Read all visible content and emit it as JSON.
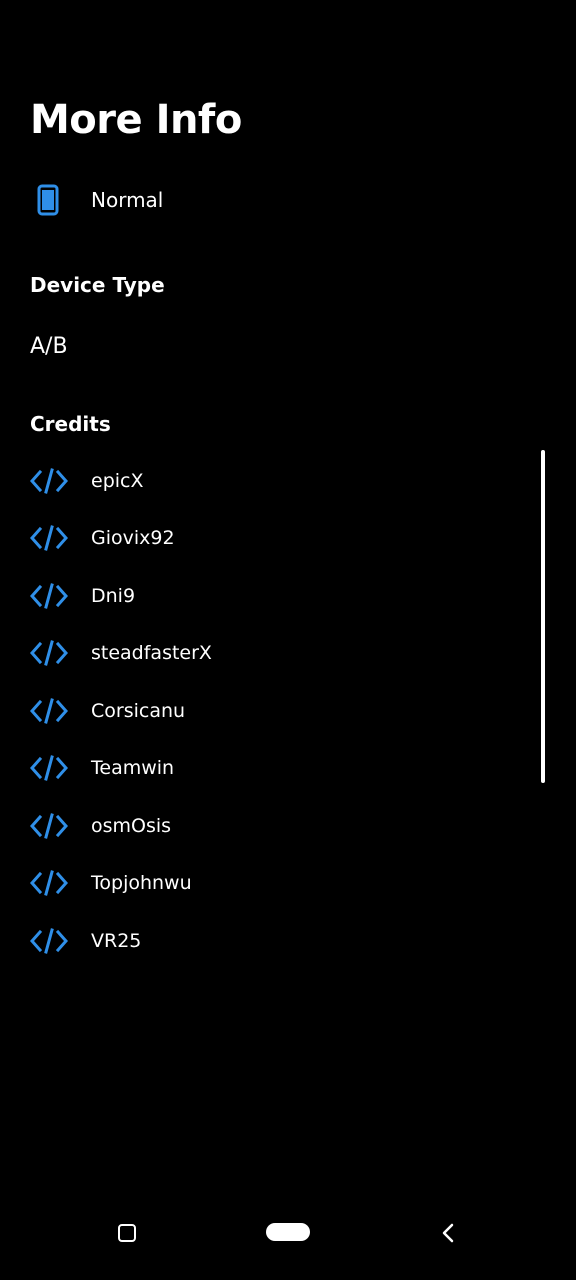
{
  "header": {
    "title": "More Info"
  },
  "mode": {
    "icon": "smartphone-icon",
    "label": "Normal"
  },
  "device_type": {
    "title": "Device Type",
    "value": "A/B"
  },
  "credits": {
    "title": "Credits",
    "icon": "code-icon",
    "items": [
      {
        "name": "epicX"
      },
      {
        "name": "Giovix92"
      },
      {
        "name": "Dni9"
      },
      {
        "name": "steadfasterX"
      },
      {
        "name": "Corsicanu"
      },
      {
        "name": "Teamwin"
      },
      {
        "name": "osmOsis"
      },
      {
        "name": "Topjohnwu"
      },
      {
        "name": "VR25"
      }
    ]
  },
  "nav_bar": {
    "recents": "recents-icon",
    "home": "home-pill-icon",
    "back": "back-chevron-icon"
  },
  "colors": {
    "background": "#000000",
    "text": "#ffffff",
    "accent": "#2f8fe8"
  }
}
